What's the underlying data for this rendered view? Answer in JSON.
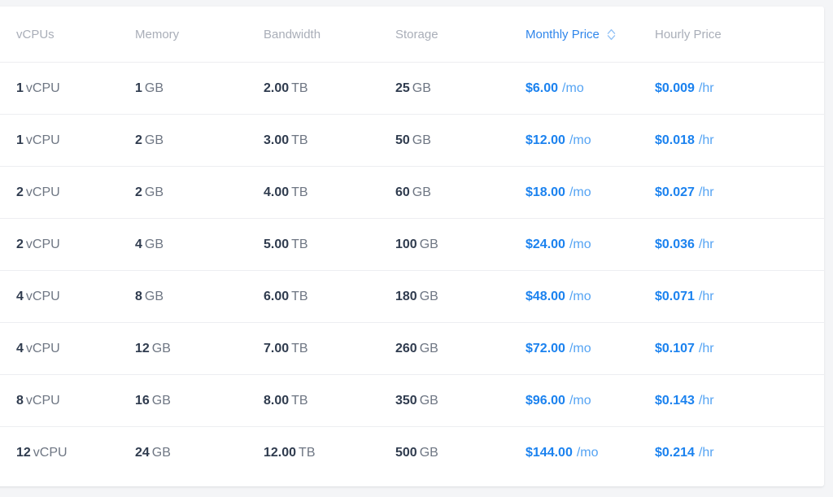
{
  "table": {
    "columns": [
      {
        "key": "vcpus",
        "label": "vCPUs",
        "sortable": false,
        "active_sort": false
      },
      {
        "key": "memory",
        "label": "Memory",
        "sortable": false,
        "active_sort": false
      },
      {
        "key": "bandwidth",
        "label": "Bandwidth",
        "sortable": false,
        "active_sort": false
      },
      {
        "key": "storage",
        "label": "Storage",
        "sortable": false,
        "active_sort": false
      },
      {
        "key": "monthly",
        "label": "Monthly Price",
        "sortable": true,
        "active_sort": true,
        "sort_icon": "sort-updown-icon"
      },
      {
        "key": "hourly",
        "label": "Hourly Price",
        "sortable": false,
        "active_sort": false
      }
    ],
    "rows": [
      {
        "vcpus_value": "1",
        "vcpus_unit": "vCPU",
        "memory_value": "1",
        "memory_unit": "GB",
        "bandwidth_value": "2.00",
        "bandwidth_unit": "TB",
        "storage_value": "25",
        "storage_unit": "GB",
        "monthly_value": "$6.00",
        "monthly_unit": "/mo",
        "hourly_value": "$0.009",
        "hourly_unit": "/hr"
      },
      {
        "vcpus_value": "1",
        "vcpus_unit": "vCPU",
        "memory_value": "2",
        "memory_unit": "GB",
        "bandwidth_value": "3.00",
        "bandwidth_unit": "TB",
        "storage_value": "50",
        "storage_unit": "GB",
        "monthly_value": "$12.00",
        "monthly_unit": "/mo",
        "hourly_value": "$0.018",
        "hourly_unit": "/hr"
      },
      {
        "vcpus_value": "2",
        "vcpus_unit": "vCPU",
        "memory_value": "2",
        "memory_unit": "GB",
        "bandwidth_value": "4.00",
        "bandwidth_unit": "TB",
        "storage_value": "60",
        "storage_unit": "GB",
        "monthly_value": "$18.00",
        "monthly_unit": "/mo",
        "hourly_value": "$0.027",
        "hourly_unit": "/hr"
      },
      {
        "vcpus_value": "2",
        "vcpus_unit": "vCPU",
        "memory_value": "4",
        "memory_unit": "GB",
        "bandwidth_value": "5.00",
        "bandwidth_unit": "TB",
        "storage_value": "100",
        "storage_unit": "GB",
        "monthly_value": "$24.00",
        "monthly_unit": "/mo",
        "hourly_value": "$0.036",
        "hourly_unit": "/hr"
      },
      {
        "vcpus_value": "4",
        "vcpus_unit": "vCPU",
        "memory_value": "8",
        "memory_unit": "GB",
        "bandwidth_value": "6.00",
        "bandwidth_unit": "TB",
        "storage_value": "180",
        "storage_unit": "GB",
        "monthly_value": "$48.00",
        "monthly_unit": "/mo",
        "hourly_value": "$0.071",
        "hourly_unit": "/hr"
      },
      {
        "vcpus_value": "4",
        "vcpus_unit": "vCPU",
        "memory_value": "12",
        "memory_unit": "GB",
        "bandwidth_value": "7.00",
        "bandwidth_unit": "TB",
        "storage_value": "260",
        "storage_unit": "GB",
        "monthly_value": "$72.00",
        "monthly_unit": "/mo",
        "hourly_value": "$0.107",
        "hourly_unit": "/hr"
      },
      {
        "vcpus_value": "8",
        "vcpus_unit": "vCPU",
        "memory_value": "16",
        "memory_unit": "GB",
        "bandwidth_value": "8.00",
        "bandwidth_unit": "TB",
        "storage_value": "350",
        "storage_unit": "GB",
        "monthly_value": "$96.00",
        "monthly_unit": "/mo",
        "hourly_value": "$0.143",
        "hourly_unit": "/hr"
      },
      {
        "vcpus_value": "12",
        "vcpus_unit": "vCPU",
        "memory_value": "24",
        "memory_unit": "GB",
        "bandwidth_value": "12.00",
        "bandwidth_unit": "TB",
        "storage_value": "500",
        "storage_unit": "GB",
        "monthly_value": "$144.00",
        "monthly_unit": "/mo",
        "hourly_value": "$0.214",
        "hourly_unit": "/hr"
      }
    ]
  },
  "colors": {
    "page_background": "#f4f5f7",
    "card_background": "#ffffff",
    "header_text": "#a9aeb8",
    "header_active": "#2f86eb",
    "value_text": "#2f3b4e",
    "unit_text": "#6e7683",
    "price_value": "#1b82ef",
    "price_unit": "#54a3f3",
    "row_divider": "#edeef1"
  }
}
